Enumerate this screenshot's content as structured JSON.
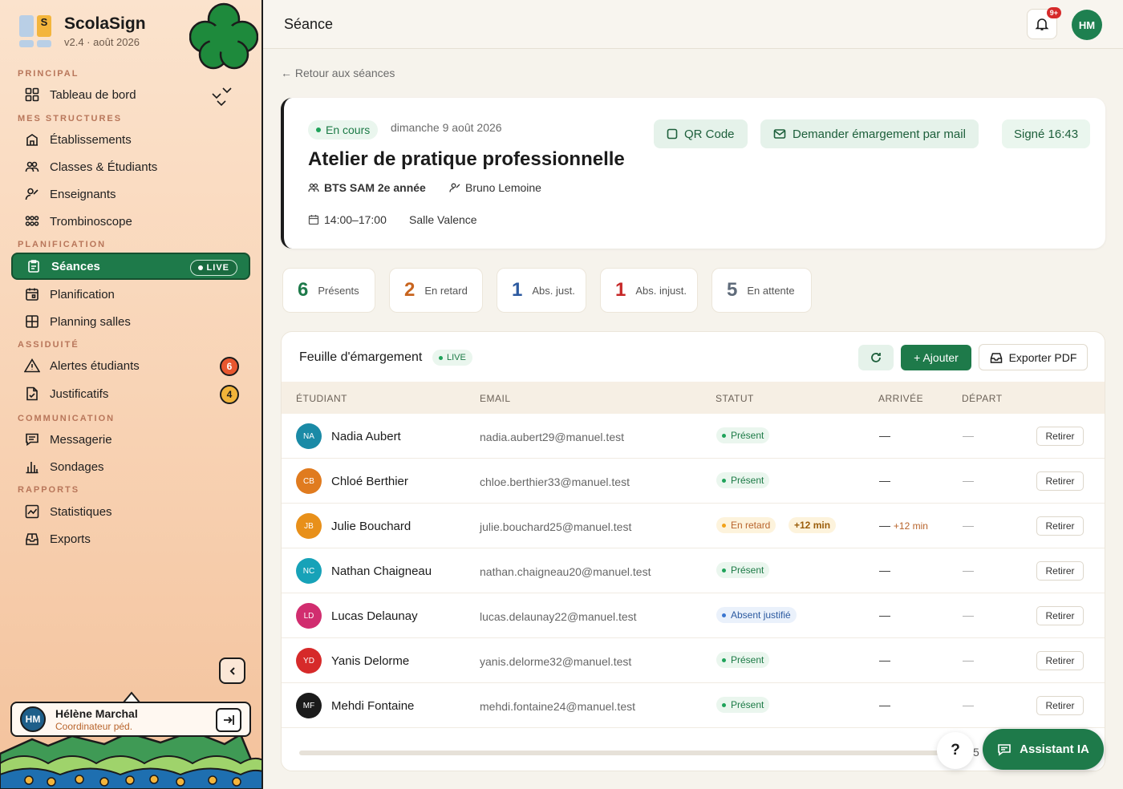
{
  "app": {
    "name": "ScolaSign",
    "version": "v2.4 · août 2026",
    "logo_letter": "S"
  },
  "sidebar": {
    "sections": {
      "principal": "PRINCIPAL",
      "structures": "MES STRUCTURES",
      "planification": "PLANIFICATION",
      "assiduite": "ASSIDUITÉ",
      "communication": "COMMUNICATION",
      "rapports": "RAPPORTS"
    },
    "items": {
      "dashboard": "Tableau de bord",
      "etablissements": "Établissements",
      "classes": "Classes & Étudiants",
      "enseignants": "Enseignants",
      "trombinoscope": "Trombinoscope",
      "seances": "Séances",
      "planification": "Planification",
      "planning_salles": "Planning salles",
      "alertes": "Alertes étudiants",
      "justificatifs": "Justificatifs",
      "messagerie": "Messagerie",
      "sondages": "Sondages",
      "statistiques": "Statistiques",
      "exports": "Exports"
    },
    "live_label": "LIVE",
    "alertes_count": "6",
    "justificatifs_count": "4",
    "user": {
      "initials": "HM",
      "name": "Hélène Marchal",
      "role": "Coordinateur péd."
    }
  },
  "header": {
    "title": "Séance",
    "notif_badge": "9+",
    "avatar_initials": "HM"
  },
  "back_link": "← Retour aux séances",
  "session": {
    "status": "En cours",
    "date": "dimanche 9 août 2026",
    "title": "Atelier de pratique professionnelle",
    "class": "BTS SAM 2e année",
    "teacher": "Bruno Lemoine",
    "time": "14:00–17:00",
    "room": "Salle Valence",
    "qr_label": "QR Code",
    "mail_label": "Demander émargement par mail",
    "signed_label": "Signé 16:43"
  },
  "stats": [
    {
      "value": "6",
      "label": "Présents",
      "color": "#1e7a4a"
    },
    {
      "value": "2",
      "label": "En retard",
      "color": "#c8641e"
    },
    {
      "value": "1",
      "label": "Abs. just.",
      "color": "#2c5aa0"
    },
    {
      "value": "1",
      "label": "Abs. injust.",
      "color": "#c62828"
    },
    {
      "value": "5",
      "label": "En attente",
      "color": "#5f6b7a"
    }
  ],
  "sheet": {
    "title": "Feuille d'émargement",
    "live": "LIVE",
    "add_label": "+ Ajouter",
    "export_label": "Exporter PDF",
    "columns": {
      "student": "ÉTUDIANT",
      "email": "EMAIL",
      "status": "STATUT",
      "arrival": "ARRIVÉE",
      "departure": "DÉPART"
    },
    "rows": [
      {
        "initials": "NA",
        "color": "#1a8aa6",
        "name": "Nadia Aubert",
        "email": "nadia.aubert29@manuel.test",
        "status": "Présent",
        "kind": "present",
        "late": "",
        "arrival": "—",
        "arrival_note": "",
        "departure": "—",
        "action": "Retirer"
      },
      {
        "initials": "CB",
        "color": "#e07b1f",
        "name": "Chloé Berthier",
        "email": "chloe.berthier33@manuel.test",
        "status": "Présent",
        "kind": "present",
        "late": "",
        "arrival": "—",
        "arrival_note": "",
        "departure": "—",
        "action": "Retirer"
      },
      {
        "initials": "JB",
        "color": "#e8901a",
        "name": "Julie Bouchard",
        "email": "julie.bouchard25@manuel.test",
        "status": "En retard",
        "kind": "late",
        "late": "+12 min",
        "arrival": "—",
        "arrival_note": "+12 min",
        "departure": "—",
        "action": "Retirer"
      },
      {
        "initials": "NC",
        "color": "#17a2b8",
        "name": "Nathan Chaigneau",
        "email": "nathan.chaigneau20@manuel.test",
        "status": "Présent",
        "kind": "present",
        "late": "",
        "arrival": "—",
        "arrival_note": "",
        "departure": "—",
        "action": "Retirer"
      },
      {
        "initials": "LD",
        "color": "#d12d6f",
        "name": "Lucas Delaunay",
        "email": "lucas.delaunay22@manuel.test",
        "status": "Absent justifié",
        "kind": "just",
        "late": "",
        "arrival": "—",
        "arrival_note": "",
        "departure": "—",
        "action": "Retirer"
      },
      {
        "initials": "YD",
        "color": "#d62a2a",
        "name": "Yanis Delorme",
        "email": "yanis.delorme32@manuel.test",
        "status": "Présent",
        "kind": "present",
        "late": "",
        "arrival": "—",
        "arrival_note": "",
        "departure": "—",
        "action": "Retirer"
      },
      {
        "initials": "MF",
        "color": "#1b1b1b",
        "name": "Mehdi Fontaine",
        "email": "mehdi.fontaine24@manuel.test",
        "status": "Présent",
        "kind": "present",
        "late": "",
        "arrival": "—",
        "arrival_note": "",
        "departure": "—",
        "action": "Retirer"
      }
    ]
  },
  "floating": {
    "help": "?",
    "page_num": "5",
    "assistant": "Assistant IA"
  }
}
